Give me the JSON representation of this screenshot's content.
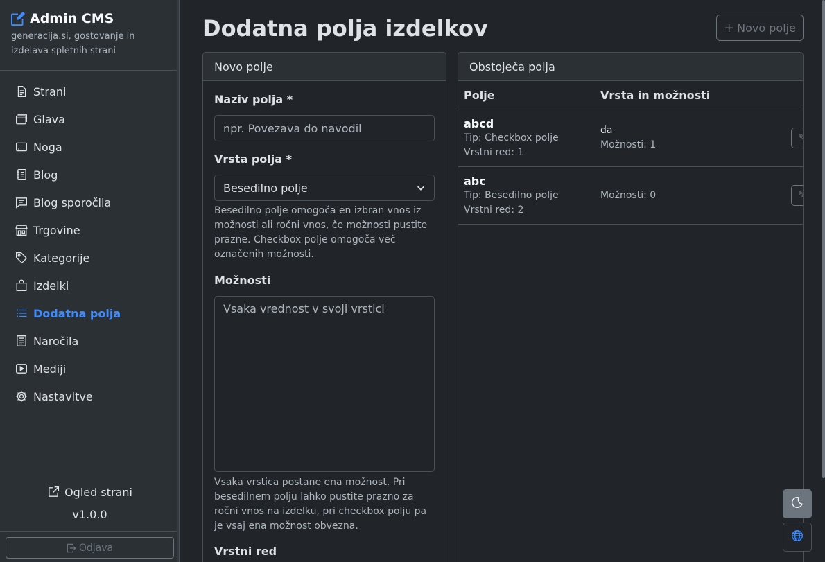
{
  "sidebar": {
    "title": "Admin CMS",
    "subtitle": "generacija.si, gostovanje in izdelava spletnih strani",
    "items": [
      {
        "label": "Strani",
        "icon": "file-icon"
      },
      {
        "label": "Glava",
        "icon": "window-stack-icon"
      },
      {
        "label": "Noga",
        "icon": "window-dots-icon"
      },
      {
        "label": "Blog",
        "icon": "journal-icon"
      },
      {
        "label": "Blog sporočila",
        "icon": "chat-icon"
      },
      {
        "label": "Trgovine",
        "icon": "shop-icon"
      },
      {
        "label": "Kategorije",
        "icon": "tags-icon"
      },
      {
        "label": "Izdelki",
        "icon": "bag-icon"
      },
      {
        "label": "Dodatna polja",
        "icon": "list-icon",
        "active": true
      },
      {
        "label": "Naročila",
        "icon": "receipt-icon"
      },
      {
        "label": "Mediji",
        "icon": "media-icon"
      },
      {
        "label": "Nastavitve",
        "icon": "gear-icon"
      }
    ],
    "view_site": "Ogled strani",
    "version": "v1.0.0",
    "logout": "Odjava"
  },
  "header": {
    "title": "Dodatna polja izdelkov",
    "new_button": "Novo polje"
  },
  "form": {
    "card_title": "Novo polje",
    "name_label": "Naziv polja *",
    "name_placeholder": "npr. Povezava do navodil",
    "type_label": "Vrsta polja *",
    "type_value": "Besedilno polje",
    "type_help": "Besedilno polje omogoča en izbran vnos iz možnosti ali ročni vnos, če možnosti pustite prazne. Checkbox polje omogoča več označenih možnosti.",
    "options_label": "Možnosti",
    "options_placeholder": "Vsaka vrednost v svoji vrstici",
    "options_help": "Vsaka vrstica postane ena možnost. Pri besedilnem polju lahko pustite prazno za ročni vnos na izdelku, pri checkbox polju pa je vsaj ena možnost obvezna.",
    "order_label": "Vrstni red"
  },
  "list": {
    "card_title": "Obstoječa polja",
    "col_field": "Polje",
    "col_type": "Vrsta in možnosti",
    "rows": [
      {
        "name": "abcd",
        "type": "Tip: Checkbox polje",
        "order": "Vrstni red: 1",
        "value": "da",
        "options": "Možnosti: 1"
      },
      {
        "name": "abc",
        "type": "Tip: Besedilno polje",
        "order": "Vrstni red: 2",
        "value": "",
        "options": "Možnosti: 0"
      }
    ]
  },
  "colors": {
    "accent": "#3d8bfd",
    "background": "#212529",
    "sidebar": "#2b3035",
    "border": "#495057"
  }
}
